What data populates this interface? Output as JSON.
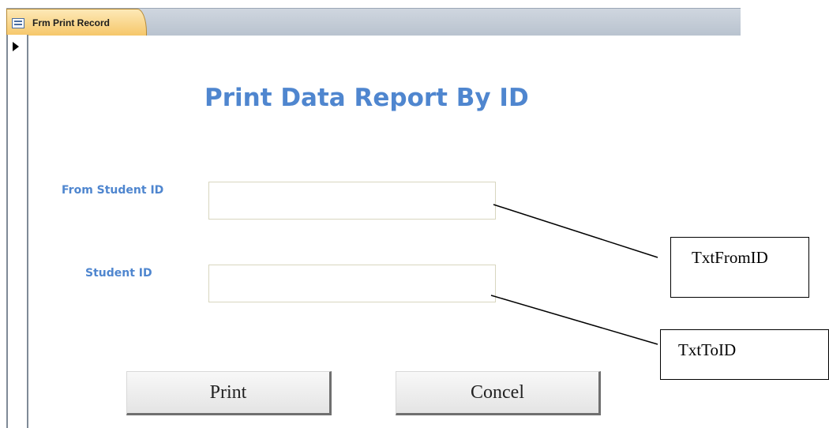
{
  "tab": {
    "label": "Frm Print Record",
    "icon": "form-icon"
  },
  "form": {
    "title": "Print Data Report By ID",
    "title_color": "#4f86cf",
    "from_label": "From Student ID",
    "to_label": "Student ID",
    "from_value": "",
    "to_value": "",
    "print_label": "Print",
    "cancel_label": "Concel"
  },
  "annotations": {
    "from_callout": "TxtFromID",
    "to_callout": "TxtToID"
  }
}
